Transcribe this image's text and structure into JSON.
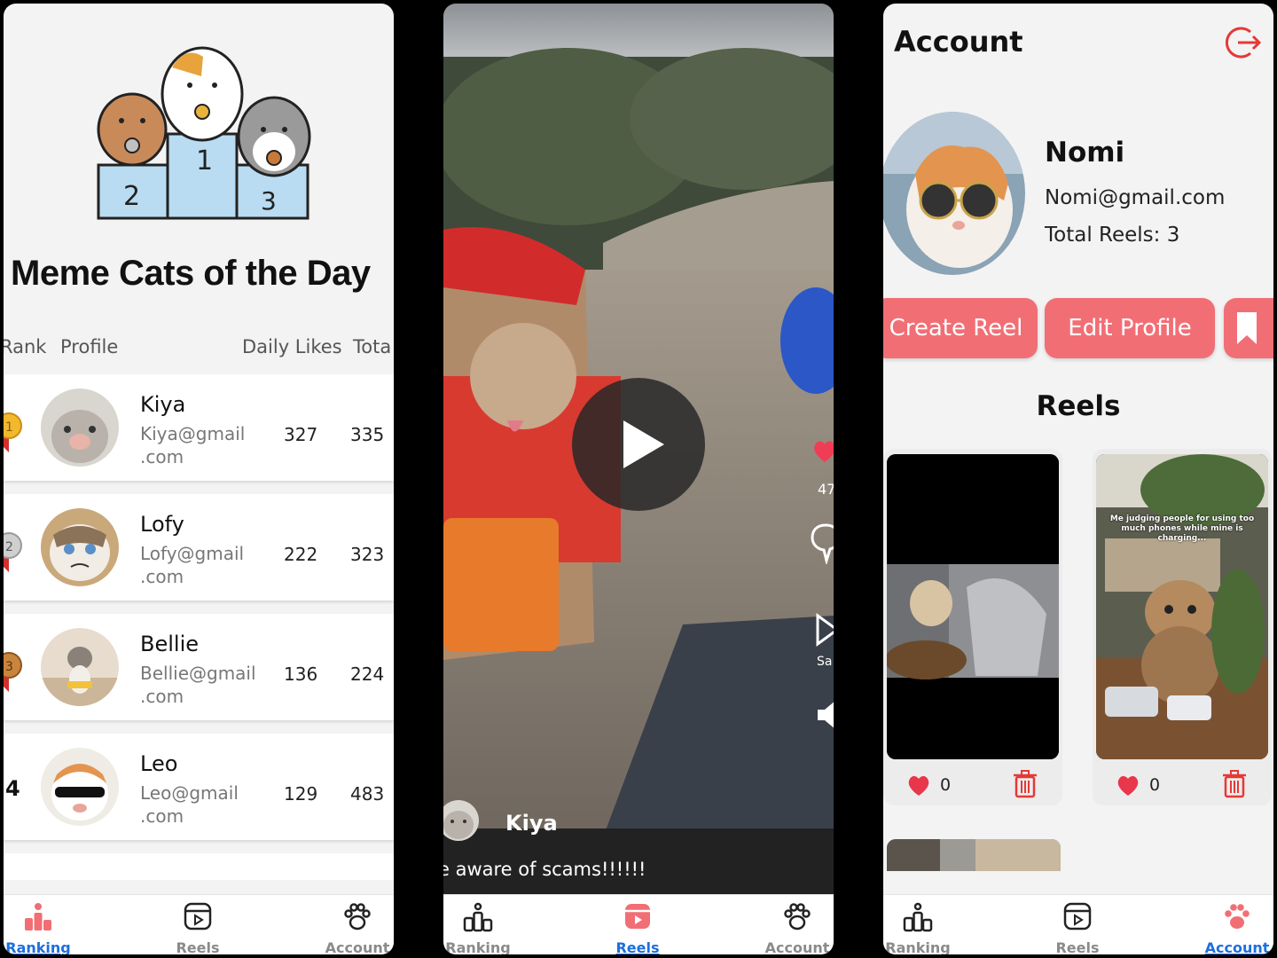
{
  "colors": {
    "accent": "#f26e75",
    "nav_active": "#1c6fe0",
    "heart": "#e8364b",
    "trash": "#e53935"
  },
  "ranking": {
    "title": "Meme Cats of the Day",
    "columns": [
      "Rank",
      "Profile",
      "Daily Likes",
      "Tota"
    ],
    "rows": [
      {
        "rank": "1",
        "medal": "gold-medal-icon",
        "name": "Kiya",
        "email_line1": "Kiya@gmail",
        "email_line2": ".com",
        "daily": "327",
        "total": "335"
      },
      {
        "rank": "2",
        "medal": "silver-medal-icon",
        "name": "Lofy",
        "email_line1": "Lofy@gmail",
        "email_line2": ".com",
        "daily": "222",
        "total": "323"
      },
      {
        "rank": "3",
        "medal": "bronze-medal-icon",
        "name": "Bellie",
        "email_line1": "Bellie@gmail",
        "email_line2": ".com",
        "daily": "136",
        "total": "224"
      },
      {
        "rank": "4",
        "medal": "",
        "name": "Leo",
        "email_line1": "Leo@gmail",
        "email_line2": ".com",
        "daily": "129",
        "total": "483"
      }
    ]
  },
  "reels": {
    "user": "Kiya",
    "caption": "e aware of scams!!!!!!",
    "like_count": "47",
    "share_label": "Sa"
  },
  "account": {
    "title": "Account",
    "name": "Nomi",
    "email": "Nomi@gmail.com",
    "total_reels": "Total Reels: 3",
    "create_reel": "Create Reel",
    "edit_profile": "Edit Profile",
    "reels_heading": "Reels",
    "meme_text": "Me judging people for using too much phones while mine is charging...",
    "cards": [
      {
        "likes": "0"
      },
      {
        "likes": "0"
      }
    ]
  },
  "nav": {
    "ranking": "Ranking",
    "reels": "Reels",
    "account": "Account"
  }
}
